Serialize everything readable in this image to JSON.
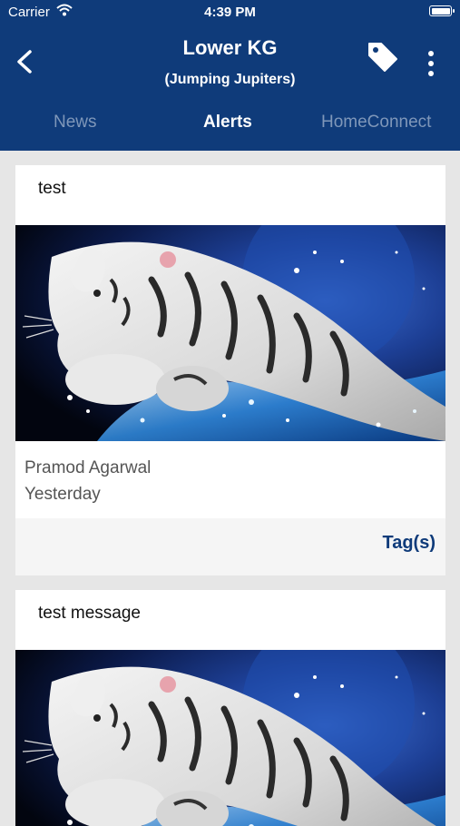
{
  "status_bar": {
    "carrier": "Carrier",
    "time": "4:39 PM"
  },
  "header": {
    "title": "Lower KG",
    "subtitle": "(Jumping Jupiters)",
    "back_icon": "chevron-left-icon",
    "tag_icon": "tag-icon",
    "more_icon": "more-vertical-icon"
  },
  "tabs": [
    {
      "label": "News",
      "active": false
    },
    {
      "label": "Alerts",
      "active": true
    },
    {
      "label": "HomeConnect",
      "active": false
    }
  ],
  "alerts": [
    {
      "title": "test",
      "author": "Pramod Agarwal",
      "date": "Yesterday",
      "tags_label": "Tag(s)",
      "image": "white tiger leaping through water"
    },
    {
      "title": "test message",
      "image": "white tiger leaping through water"
    }
  ],
  "colors": {
    "header": "#0f3b7a",
    "accent": "#0f3b7a",
    "background": "#e6e6e6",
    "inactive_tab": "#7f97b9"
  }
}
